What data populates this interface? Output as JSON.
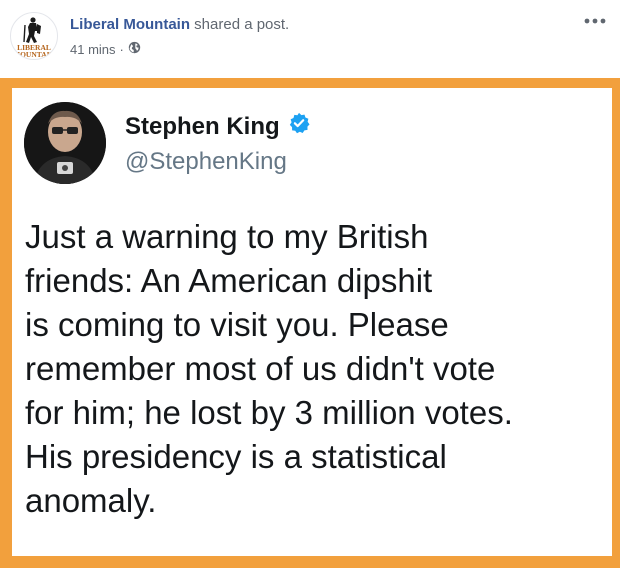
{
  "post": {
    "page_name": "Liberal Mountain",
    "action_text": " shared a post.",
    "timestamp": "41 mins",
    "separator": "·",
    "privacy_icon": "globe-icon",
    "more_icon": "more-options-icon",
    "logo_text_top": "LIBERAL",
    "logo_text_bottom": "MOUNTAIN"
  },
  "colors": {
    "frame": "#f2a03d",
    "page_link": "#385898",
    "verified": "#1da1f2",
    "handle": "#657786"
  },
  "tweet": {
    "author_name": "Stephen King",
    "verified_icon": "verified-badge-icon",
    "handle": "@StephenKing",
    "text_lines": [
      "Just a warning to my British",
      "friends: An American dipshit",
      "is coming to visit you. Please",
      "remember most of us didn't vote",
      "for him; he lost by 3 million votes.",
      "His presidency is a statistical",
      "anomaly."
    ]
  }
}
